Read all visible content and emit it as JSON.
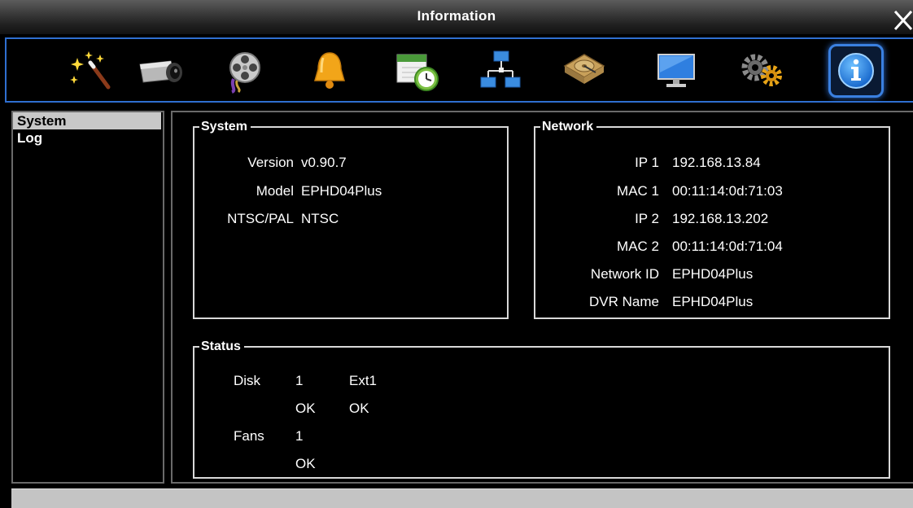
{
  "window": {
    "title": "Information"
  },
  "toolbar": {
    "items": [
      {
        "name": "wizard",
        "icon": "magic-wand-icon"
      },
      {
        "name": "camera",
        "icon": "camera-icon"
      },
      {
        "name": "record",
        "icon": "film-reel-icon"
      },
      {
        "name": "alarm",
        "icon": "bell-icon"
      },
      {
        "name": "schedule",
        "icon": "calendar-clock-icon"
      },
      {
        "name": "network",
        "icon": "network-icon"
      },
      {
        "name": "storage",
        "icon": "hard-disk-icon"
      },
      {
        "name": "display",
        "icon": "monitor-icon"
      },
      {
        "name": "settings",
        "icon": "gears-icon"
      },
      {
        "name": "information",
        "icon": "info-icon",
        "active": true
      }
    ]
  },
  "sidebar": {
    "items": [
      {
        "label": "System",
        "selected": true
      },
      {
        "label": "Log",
        "selected": false
      }
    ]
  },
  "system": {
    "legend": "System",
    "version_label": "Version",
    "version_value": "v0.90.7",
    "model_label": "Model",
    "model_value": "EPHD04Plus",
    "video_label": "NTSC/PAL",
    "video_value": "NTSC"
  },
  "network": {
    "legend": "Network",
    "ip1_label": "IP 1",
    "ip1_value": "192.168.13.84",
    "mac1_label": "MAC 1",
    "mac1_value": "00:11:14:0d:71:03",
    "ip2_label": "IP 2",
    "ip2_value": "192.168.13.202",
    "mac2_label": "MAC 2",
    "mac2_value": "00:11:14:0d:71:04",
    "netid_label": "Network ID",
    "netid_value": "EPHD04Plus",
    "dvrname_label": "DVR Name",
    "dvrname_value": "EPHD04Plus"
  },
  "status": {
    "legend": "Status",
    "disk_label": "Disk",
    "disk_col1": "1",
    "disk_col2": "Ext1",
    "disk_state1": "OK",
    "disk_state2": "OK",
    "fans_label": "Fans",
    "fans_col1": "1",
    "fans_state1": "OK"
  },
  "colors": {
    "accent_border": "#2f6fd0",
    "panel_border": "#6a6a6a",
    "selected_bg": "#c8c8c8",
    "background": "#000000"
  }
}
